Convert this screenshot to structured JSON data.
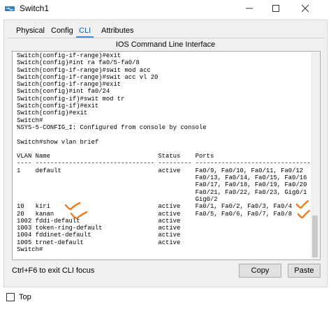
{
  "window": {
    "title": "Switch1",
    "minimize_icon": "minimize-icon",
    "maximize_icon": "maximize-icon",
    "close_icon": "close-icon"
  },
  "tabs": [
    {
      "label": "Physical",
      "active": false
    },
    {
      "label": "Config",
      "active": false
    },
    {
      "label": "CLI",
      "active": true
    },
    {
      "label": "Attributes",
      "active": false
    }
  ],
  "cli": {
    "pane_title": "IOS Command Line Interface",
    "lines": [
      "Switch(config-if-range)#exit",
      "Switch(config)#int ra fa0/5-fa0/8",
      "Switch(config-if-range)#swit mod acc",
      "Switch(config-if-range)#swit acc vl 20",
      "Switch(config-if-range)#exit",
      "Switch(config)#int fa0/24",
      "Switch(config-if)#swit mod tr",
      "Switch(config-if)#exit",
      "Switch(config)#exit",
      "Switch#",
      "%SYS-5-CONFIG_I: Configured from console by console",
      "",
      "Switch#show vlan brief",
      "",
      "VLAN Name                             Status    Ports",
      "---- -------------------------------- --------- -------------------------------",
      "1    default                          active    Fa0/9, Fa0/10, Fa0/11, Fa0/12",
      "                                                Fa0/13, Fa0/14, Fa0/15, Fa0/16",
      "                                                Fa0/17, Fa0/18, Fa0/19, Fa0/20",
      "                                                Fa0/21, Fa0/22, Fa0/23, Gig0/1",
      "                                                Gig0/2",
      "10   kiri                             active    Fa0/1, Fa0/2, Fa0/3, Fa0/4",
      "20   kanan                            active    Fa0/5, Fa0/6, Fa0/7, Fa0/8",
      "1002 fddi-default                     active",
      "1003 token-ring-default               active",
      "1004 fddinet-default                  active",
      "1005 trnet-default                    active",
      "Switch#"
    ],
    "annotation_color": "#f07a1a"
  },
  "footer": {
    "hint": "Ctrl+F6 to exit CLI focus",
    "copy_label": "Copy",
    "paste_label": "Paste"
  },
  "bottom": {
    "top_label": "Top",
    "top_checked": false
  }
}
